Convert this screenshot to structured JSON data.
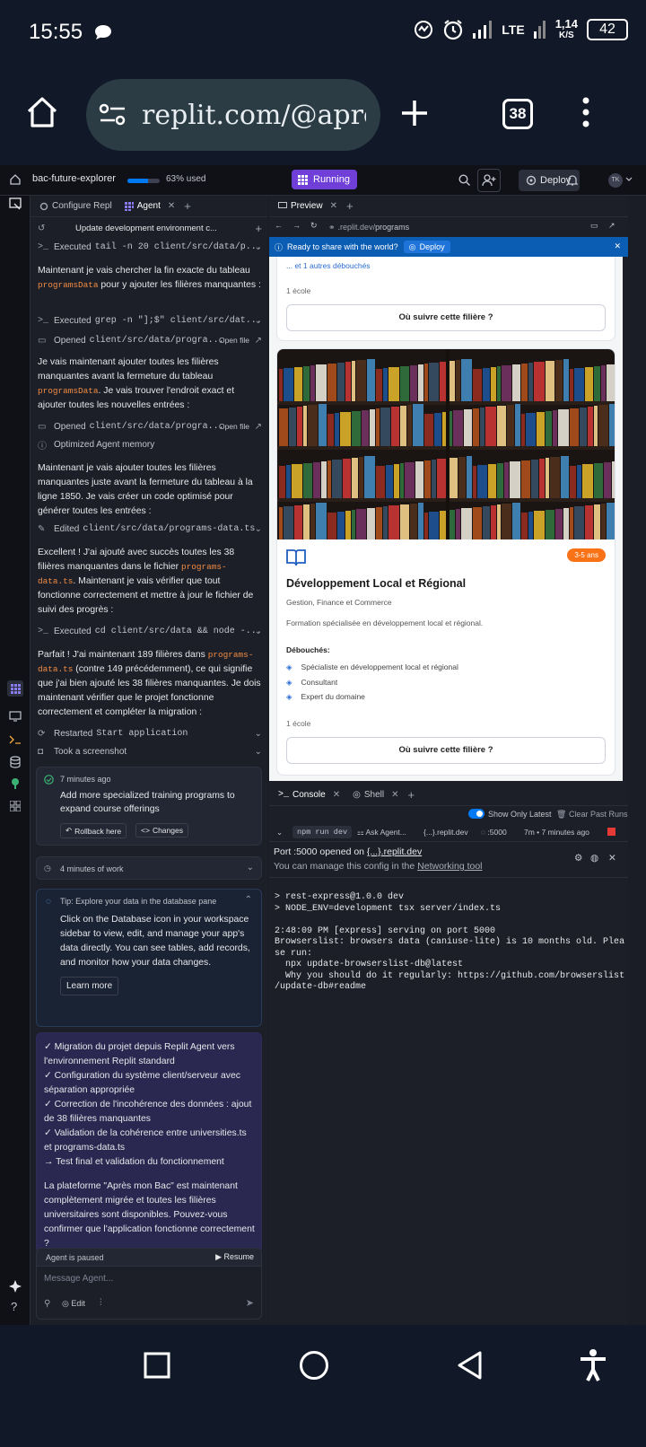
{
  "status": {
    "time": "15:55",
    "net_type": "LTE",
    "speed": "1,14",
    "speed_unit": "K/S",
    "battery": "42"
  },
  "browser": {
    "url": "replit.com/@apre",
    "tab_count": "38"
  },
  "topbar": {
    "project": "bac-future-explorer",
    "usage_label": "63% used",
    "usage_fraction": 0.63,
    "run_label": "Running",
    "deploy_label": "Deploy",
    "avatar": "TK"
  },
  "agent": {
    "tabs": {
      "configure": "Configure Repl",
      "agent": "Agent"
    },
    "header": "Update development environment c...",
    "exec1": {
      "label": "Executed",
      "cmd": "tail -n 20 client/src/data/p..."
    },
    "p1": {
      "a": "Maintenant je vais chercher la fin exacte du tableau ",
      "code": "programsData",
      "b": " pour y ajouter les filières manquantes :"
    },
    "exec2": {
      "label": "Executed",
      "cmd": "grep -n \"];$\" client/src/dat..."
    },
    "open1": {
      "label": "Opened",
      "path": "client/src/data/progra...",
      "action": "Open file"
    },
    "p2": {
      "a": "Je vais maintenant ajouter toutes les filières manquantes avant la fermeture du tableau ",
      "code": "programsData",
      "b": ". Je vais trouver l'endroit exact et ajouter toutes les nouvelles entrées :"
    },
    "open2": {
      "label": "Opened",
      "path": "client/src/data/progra...",
      "action": "Open file"
    },
    "memory": "Optimized Agent memory",
    "p3": "Maintenant je vais ajouter toutes les filières manquantes juste avant la fermeture du tableau à la ligne 1850. Je vais créer un code optimisé pour générer toutes les entrées :",
    "edit": {
      "label": "Edited",
      "path": "client/src/data/programs-data.ts"
    },
    "p4": {
      "a": "Excellent ! J'ai ajouté avec succès toutes les 38 filières manquantes dans le fichier ",
      "code": "programs-data.ts",
      "b": ". Maintenant je vais vérifier que tout fonctionne correctement et mettre à jour le fichier de suivi des progrès :"
    },
    "exec3": {
      "label": "Executed",
      "cmd": "cd client/src/data && node -..."
    },
    "p5": {
      "a": "Parfait ! J'ai maintenant 189 filières dans ",
      "code": "programs-data.ts",
      "b": " (contre 149 précédemment), ce qui signifie que j'ai bien ajouté les 38 filières manquantes. Je dois maintenant vérifier que le projet fonctionne correctement et compléter la migration :"
    },
    "restart": {
      "label": "Restarted",
      "cmd": "Start application"
    },
    "screenshot": "Took a screenshot",
    "checkpoint": {
      "time": "7 minutes ago",
      "text": "Add more specialized training programs to expand course offerings",
      "rollback": "Rollback here",
      "changes": "Changes"
    },
    "work": "4 minutes of work",
    "tip": {
      "title": "Tip: Explore your data in the database pane",
      "body": "Click on the Database icon in your workspace sidebar to view, edit, and manage your app's data directly. You can see tables, add records, and monitor how your data changes.",
      "button": "Learn more"
    },
    "summary": {
      "lines": [
        "✓ Migration du projet depuis Replit Agent vers l'environnement Replit standard",
        "✓ Configuration du système client/serveur avec séparation appropriée",
        "✓ Correction de l'incohérence des données : ajout de 38 filières manquantes",
        "✓ Validation de la cohérence entre universities.ts et programs-data.ts",
        "→ Test final et validation du fonctionnement"
      ],
      "body": "La plateforme \"Après mon Bac\" est maintenant complètement migrée et toutes les filières universitaires sont disponibles. Pouvez-vous confirmer que l'application fonctionne correctement ?"
    },
    "input": {
      "paused": "Agent is paused",
      "resume": "Resume",
      "placeholder": "Message Agent...",
      "edit": "Edit"
    }
  },
  "preview": {
    "tab": "Preview",
    "url_prefix": ".replit.dev/",
    "url_path": "programs",
    "banner": "Ready to share with the world?",
    "banner_button": "Deploy",
    "card1": {
      "more": "... et 1 autres débouchés",
      "schools": "1 école",
      "button": "Où suivre cette filière ?"
    },
    "card2": {
      "duration": "3-5 ans",
      "title": "Développement Local et Régional",
      "field": "Gestion, Finance et Commerce",
      "desc": "Formation spécialisée en développement local et régional.",
      "outlets_label": "Débouchés:",
      "outlets": [
        "Spécialiste en développement local et régional",
        "Consultant",
        "Expert du domaine"
      ],
      "schools": "1 école",
      "button": "Où suivre cette filière ?"
    }
  },
  "console": {
    "tabs": {
      "console": "Console",
      "shell": "Shell"
    },
    "show_latest": "Show Only Latest",
    "clear": "Clear Past Runs",
    "run": {
      "cmd": "npm run dev",
      "ask": "Ask Agent...",
      "domain": "{...}.replit.dev",
      "port": ":5000",
      "time": "7m • 7 minutes ago"
    },
    "port_line": "Port :5000 opened on ",
    "port_link": "{...}.replit.dev",
    "manage": "You can manage this config in the ",
    "manage_link": "Networking tool",
    "output": "> rest-express@1.0.0 dev\n> NODE_ENV=development tsx server/index.ts\n\n2:48:09 PM [express] serving on port 5000\nBrowserslist: browsers data (caniuse-lite) is 10 months old. Plea\nse run:\n  npx update-browserslist-db@latest\n  Why you should do it regularly: https://github.com/browserslist\n/update-db#readme"
  }
}
